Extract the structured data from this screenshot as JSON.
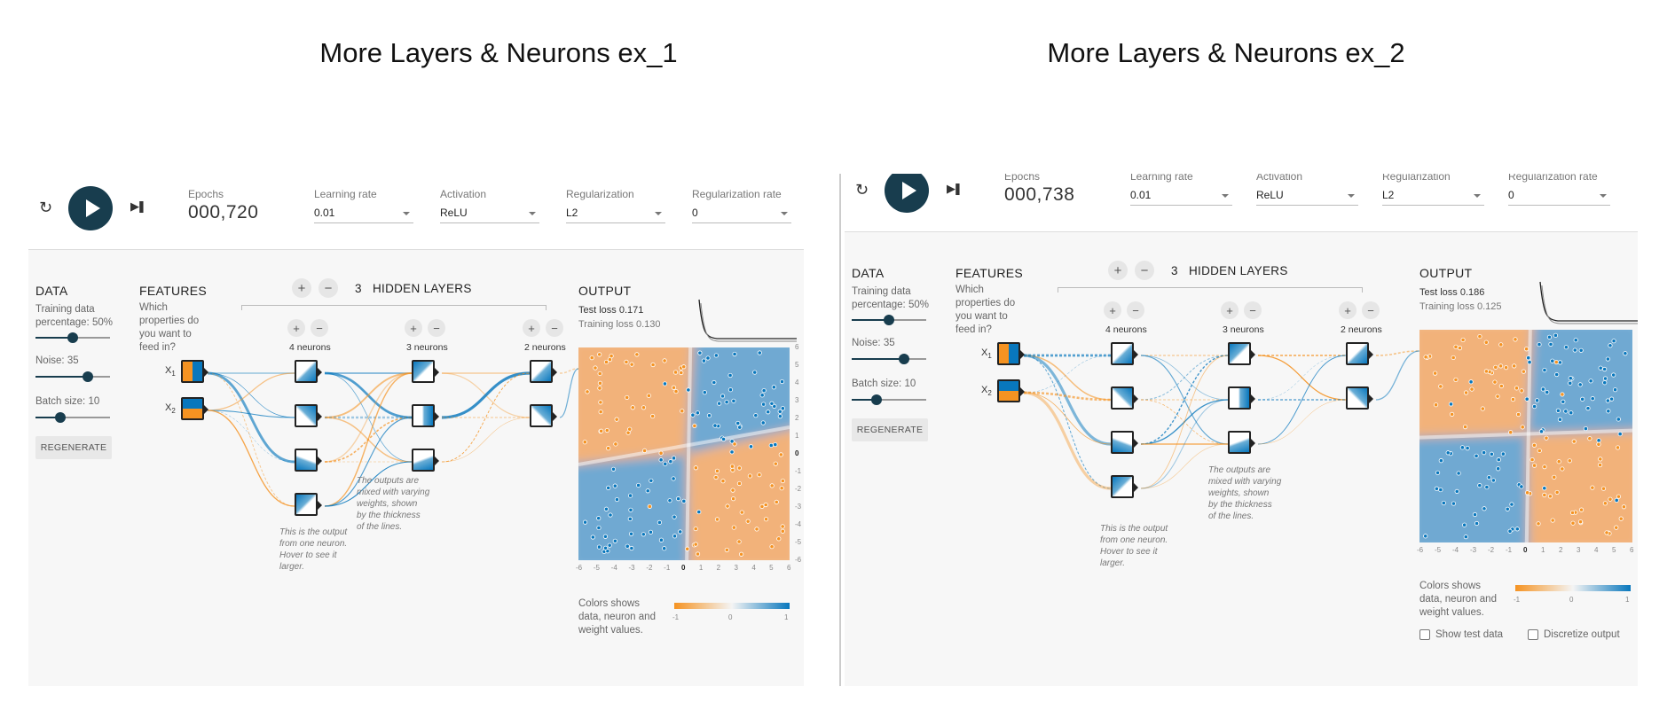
{
  "titles": [
    "More Layers & Neurons ex_1",
    "More Layers & Neurons ex_2"
  ],
  "colors": {
    "orange": "#f59322",
    "blue": "#0877bd",
    "play_button": "#183d4e"
  },
  "icons": [
    "reset-icon",
    "play-icon",
    "step-icon",
    "plus-icon",
    "minus-icon"
  ],
  "panels": [
    {
      "epochs_label": "Epochs",
      "epochs": "000,720",
      "learning_rate_label": "Learning rate",
      "learning_rate": "0.01",
      "activation_label": "Activation",
      "activation": "ReLU",
      "regularization_label": "Regularization",
      "regularization": "L2",
      "regularization_rate_label": "Regularization rate",
      "regularization_rate": "0",
      "data_title": "DATA",
      "training_pct_label": "Training data percentage:",
      "training_pct": "50%",
      "training_pct_level": 0.5,
      "noise_label": "Noise:",
      "noise": "35",
      "noise_level": 0.7,
      "batch_label": "Batch size:",
      "batch": "10",
      "batch_level": 0.33,
      "regenerate": "REGENERATE",
      "features_title": "FEATURES",
      "features_hint": "Which properties do you want to feed in?",
      "x1": "X",
      "x1_sub": "1",
      "x2": "X",
      "x2_sub": "2",
      "hidden_layers_count": "3",
      "hidden_layers_label": "HIDDEN LAYERS",
      "layers": [
        {
          "neurons_label": "4 neurons",
          "count": 4
        },
        {
          "neurons_label": "3 neurons",
          "count": 3
        },
        {
          "neurons_label": "2 neurons",
          "count": 2
        }
      ],
      "neuron_annotation": [
        "This is the output",
        "from one neuron.",
        "Hover to see it",
        "larger."
      ],
      "weights_annotation": [
        "The outputs are",
        "mixed with varying",
        "weights, shown",
        "by the thickness",
        "of the lines."
      ],
      "output_title": "OUTPUT",
      "test_loss": "Test loss 0.171",
      "training_loss": "Training loss 0.130",
      "x_ticks": [
        "-6",
        "-5",
        "-4",
        "-3",
        "-2",
        "-1",
        "0",
        "1",
        "2",
        "3",
        "4",
        "5",
        "6"
      ],
      "y_ticks": [
        "6",
        "5",
        "4",
        "3",
        "2",
        "1",
        "0",
        "-1",
        "-2",
        "-3",
        "-4",
        "-5",
        "-6"
      ],
      "colors_legend": [
        "Colors shows",
        "data, neuron and",
        "weight values."
      ],
      "legend_ticks": [
        "-1",
        "0",
        "1"
      ]
    },
    {
      "epochs_label": "Epochs",
      "epochs": "000,738",
      "learning_rate_label": "Learning rate",
      "learning_rate": "0.01",
      "activation_label": "Activation",
      "activation": "ReLU",
      "regularization_label": "Regularization",
      "regularization": "L2",
      "regularization_rate_label": "Regularization rate",
      "regularization_rate": "0",
      "data_title": "DATA",
      "training_pct_label": "Training data percentage:",
      "training_pct": "50%",
      "training_pct_level": 0.5,
      "noise_label": "Noise:",
      "noise": "35",
      "noise_level": 0.7,
      "batch_label": "Batch size:",
      "batch": "10",
      "batch_level": 0.33,
      "regenerate": "REGENERATE",
      "features_title": "FEATURES",
      "features_hint": "Which properties do you want to feed in?",
      "x1": "X",
      "x1_sub": "1",
      "x2": "X",
      "x2_sub": "2",
      "hidden_layers_count": "3",
      "hidden_layers_label": "HIDDEN LAYERS",
      "layers": [
        {
          "neurons_label": "4 neurons",
          "count": 4
        },
        {
          "neurons_label": "3 neurons",
          "count": 3
        },
        {
          "neurons_label": "2 neurons",
          "count": 2
        }
      ],
      "neuron_annotation": [
        "This is the output",
        "from one neuron.",
        "Hover to see it",
        "larger."
      ],
      "weights_annotation": [
        "The outputs are",
        "mixed with varying",
        "weights, shown",
        "by the thickness",
        "of the lines."
      ],
      "output_title": "OUTPUT",
      "test_loss": "Test loss 0.186",
      "training_loss": "Training loss 0.125",
      "x_ticks": [
        "-6",
        "-5",
        "-4",
        "-3",
        "-2",
        "-1",
        "0",
        "1",
        "2",
        "3",
        "4",
        "5",
        "6"
      ],
      "y_ticks": [
        "6",
        "5",
        "4",
        "3",
        "2",
        "1",
        "0",
        "-1",
        "-2",
        "-3",
        "-4",
        "-5",
        "-6"
      ],
      "colors_legend": [
        "Colors shows",
        "data, neuron and",
        "weight values."
      ],
      "legend_ticks": [
        "-1",
        "0",
        "1"
      ],
      "show_test_data": "Show test data",
      "discretize_output": "Discretize output"
    }
  ]
}
